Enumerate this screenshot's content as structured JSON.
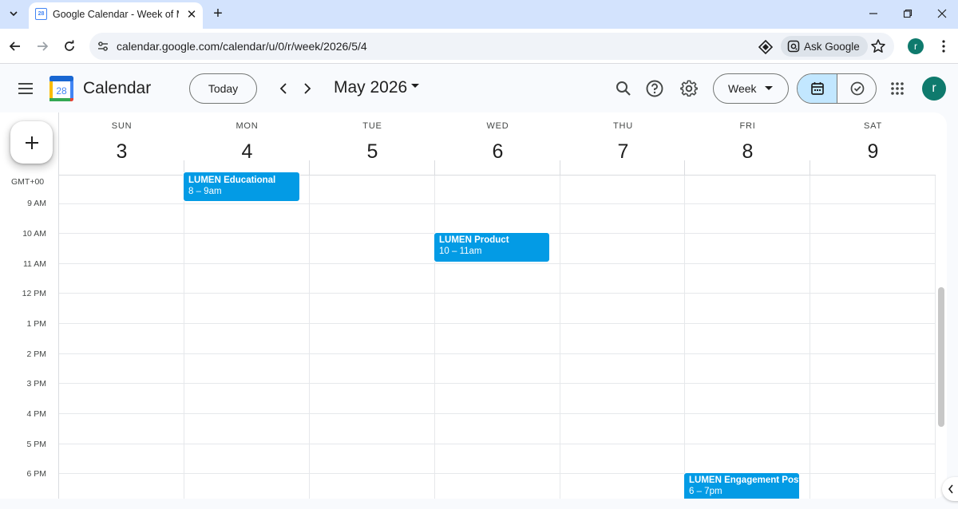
{
  "browser": {
    "tab_title": "Google Calendar - Week of May",
    "favicon_text": "28",
    "url": "calendar.google.com/calendar/u/0/r/week/2026/5/4",
    "ask_google_label": "Ask Google",
    "profile_initial": "r",
    "icons": [
      "tab-search-icon",
      "close-icon",
      "plus-icon",
      "minimize-icon",
      "restore-icon",
      "close-window-icon",
      "back-icon",
      "forward-icon",
      "reload-icon",
      "site-info-icon",
      "lens-icon",
      "star-icon",
      "kebab-icon"
    ]
  },
  "header": {
    "logo_text": "28",
    "app_title": "Calendar",
    "today_label": "Today",
    "month_title": "May 2026",
    "view_label": "Week",
    "avatar_initial": "r",
    "icons": [
      "menu-icon",
      "chevron-left-icon",
      "chevron-right-icon",
      "search-icon",
      "help-icon",
      "gear-icon",
      "calendar-view-icon",
      "tasks-icon",
      "apps-grid-icon"
    ]
  },
  "week": {
    "days": [
      {
        "dow": "SUN",
        "date": "3"
      },
      {
        "dow": "MON",
        "date": "4"
      },
      {
        "dow": "TUE",
        "date": "5"
      },
      {
        "dow": "WED",
        "date": "6"
      },
      {
        "dow": "THU",
        "date": "7"
      },
      {
        "dow": "FRI",
        "date": "8"
      },
      {
        "dow": "SAT",
        "date": "9"
      }
    ],
    "timezone": "GMT+00",
    "hours": [
      "9 AM",
      "10 AM",
      "11 AM",
      "12 PM",
      "1 PM",
      "2 PM",
      "3 PM",
      "4 PM",
      "5 PM",
      "6 PM"
    ]
  },
  "events": [
    {
      "title": "LUMEN Educational",
      "time": "8 – 9am",
      "day": "MON"
    },
    {
      "title": "LUMEN Product",
      "time": "10 – 11am",
      "day": "WED"
    },
    {
      "title": "LUMEN Engagement Post",
      "time": "6 – 7pm",
      "day": "FRI"
    }
  ],
  "colors": {
    "event": "#039be5",
    "avatar": "#0f7a6d",
    "selected_view": "#c2e7ff",
    "tabbar": "#d3e3fd"
  }
}
